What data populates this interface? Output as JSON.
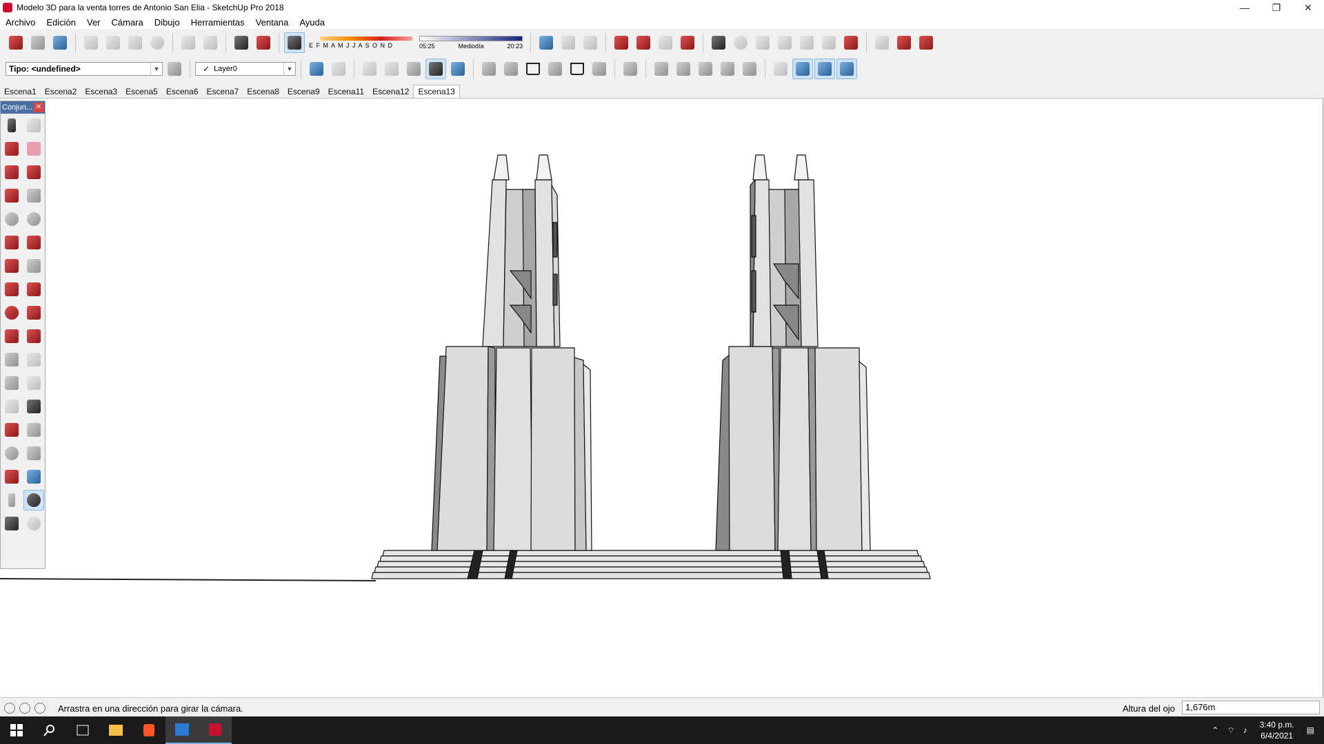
{
  "window": {
    "title": "Modelo 3D para la venta torres de Antonio San Elia - SketchUp Pro 2018",
    "controls": [
      "minimize-icon",
      "restore-icon",
      "close-icon"
    ]
  },
  "menu": [
    "Archivo",
    "Edición",
    "Ver",
    "Cámara",
    "Dibujo",
    "Herramientas",
    "Ventana",
    "Ayuda"
  ],
  "toolbar": {
    "type_selector": "Tipo: <undefined>",
    "layer_check": "✓",
    "layer": "Layer0",
    "shadow_months": "E F M A M J J A S O N D",
    "time_start": "05:25",
    "time_mid": "Mediodía",
    "time_end": "20:23"
  },
  "scenes": [
    "Escena1",
    "Escena2",
    "Escena3",
    "Escena5",
    "Escena6",
    "Escena7",
    "Escena8",
    "Escena9",
    "Escena11",
    "Escena12",
    "Escena13"
  ],
  "active_scene": "Escena13",
  "toolpanel": {
    "title": "Conjun...",
    "close": "✕"
  },
  "status": {
    "message": "Arrastra en una dirección para girar la cámara.",
    "vcb_label": "Altura del ojo",
    "vcb_value": "1,676m"
  },
  "taskbar": {
    "time": "3:40 p.m.",
    "date": "6/4/2021"
  },
  "colors": {
    "tower_light": "#dcdcdc",
    "tower_mid": "#bfbfbf",
    "tower_dark": "#8a8a8a",
    "edge": "#111111"
  }
}
